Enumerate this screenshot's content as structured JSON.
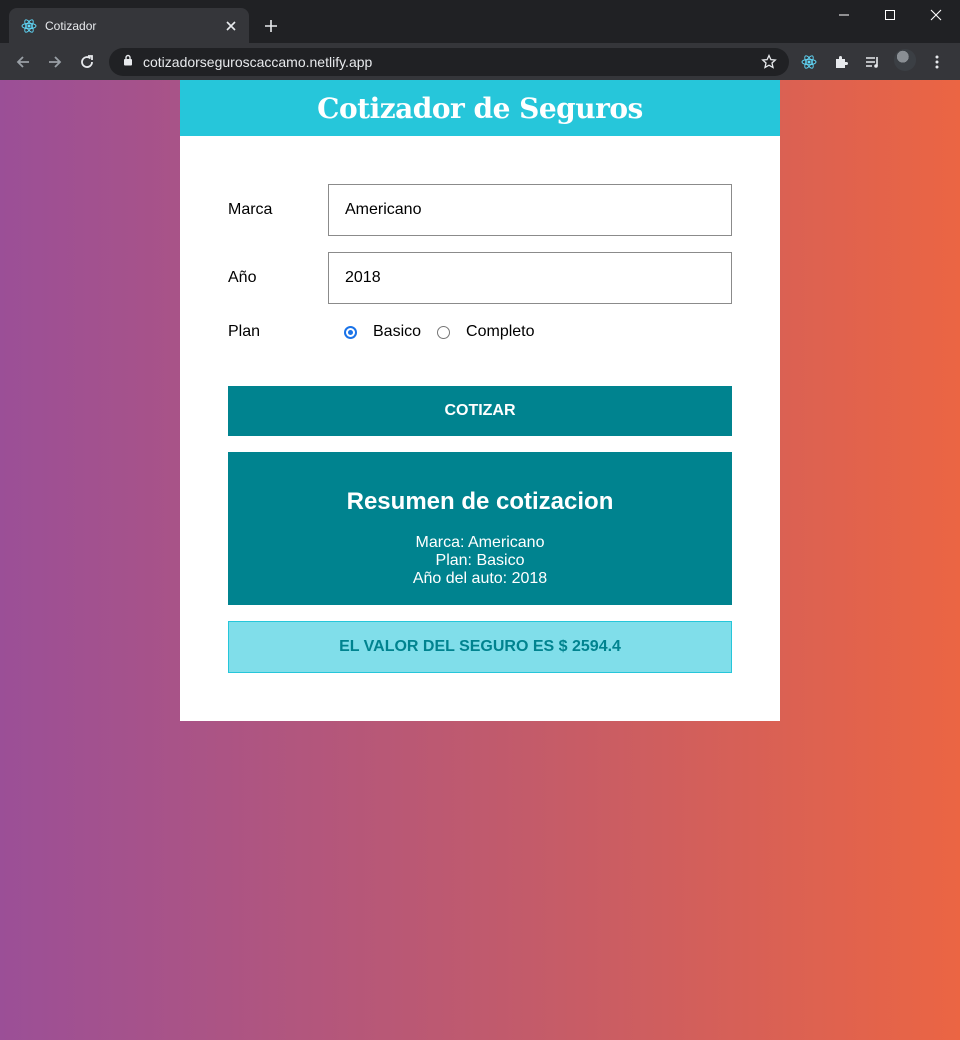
{
  "browser": {
    "tab_title": "Cotizador",
    "url": "cotizadorseguroscaccamo.netlify.app"
  },
  "colors": {
    "header": "#26c6da",
    "primary": "#00838f",
    "result_bg": "#80deea",
    "gradient_left": "#9b4f97",
    "gradient_right": "#eb6543"
  },
  "app": {
    "title": "Cotizador de Seguros",
    "form": {
      "marca_label": "Marca",
      "marca_value": "Americano",
      "year_label": "Año",
      "year_value": "2018",
      "plan_label": "Plan",
      "plan_options": [
        "Basico",
        "Completo"
      ],
      "plan_selected": "Basico"
    },
    "submit_label": "COTIZAR",
    "summary": {
      "heading": "Resumen de cotizacion",
      "marca_line": "Marca: Americano",
      "plan_line": "Plan: Basico",
      "year_line": "Año del auto: 2018"
    },
    "result_text": "EL VALOR DEL SEGURO ES $ 2594.4"
  }
}
